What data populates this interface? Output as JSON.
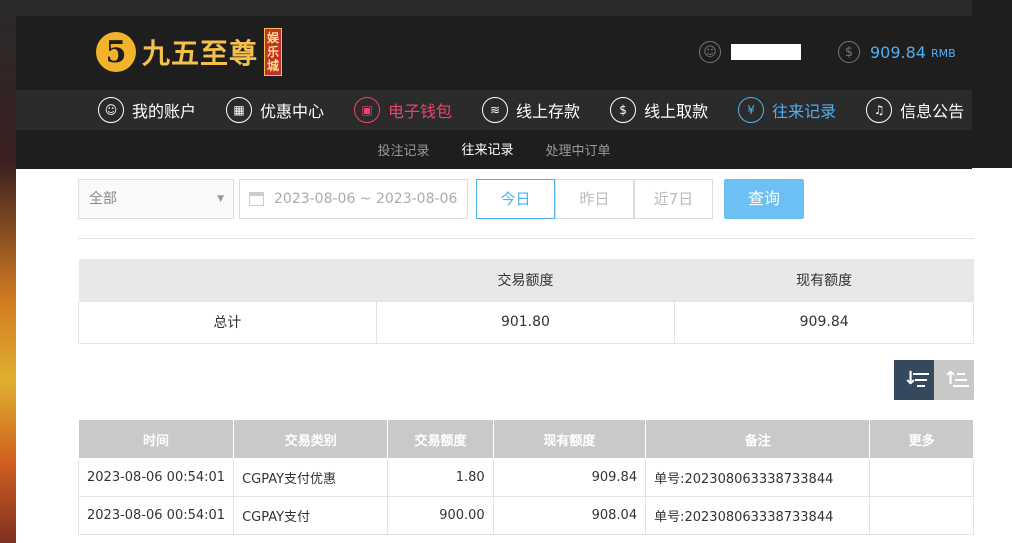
{
  "brand": {
    "name": "九五至尊",
    "badge": "娱乐城",
    "mark": "5"
  },
  "header": {
    "balance": "909.84",
    "currency": "RMB"
  },
  "nav": {
    "items": [
      {
        "label": "我的账户",
        "icon": "user-icon",
        "glyph": "☺"
      },
      {
        "label": "优惠中心",
        "icon": "gift-icon",
        "glyph": "▦"
      },
      {
        "label": "电子钱包",
        "icon": "wallet-icon",
        "glyph": "▣"
      },
      {
        "label": "线上存款",
        "icon": "deposit-icon",
        "glyph": "≋"
      },
      {
        "label": "线上取款",
        "icon": "withdraw-icon",
        "glyph": "$"
      },
      {
        "label": "往来记录",
        "icon": "records-icon",
        "glyph": "¥"
      },
      {
        "label": "信息公告",
        "icon": "bell-icon",
        "glyph": "♫"
      }
    ]
  },
  "subnav": {
    "items": [
      {
        "label": "投注记录"
      },
      {
        "label": "往来记录"
      },
      {
        "label": "处理中订单"
      }
    ]
  },
  "filters": {
    "type_value": "全部",
    "date_range": "2023-08-06 ~ 2023-08-06",
    "quick": [
      "今日",
      "昨日",
      "近7日"
    ],
    "query_label": "查询"
  },
  "summary": {
    "headers": [
      "",
      "交易额度",
      "现有额度"
    ],
    "row": [
      "总计",
      "901.80",
      "909.84"
    ]
  },
  "records": {
    "headers": [
      "时间",
      "交易类别",
      "交易额度",
      "现有额度",
      "备注",
      "更多"
    ],
    "rows": [
      [
        "2023-08-06 00:54:01",
        "CGPAY支付优惠",
        "1.80",
        "909.84",
        "单号:202308063338733844",
        ""
      ],
      [
        "2023-08-06 00:54:01",
        "CGPAY支付",
        "900.00",
        "908.04",
        "单号:202308063338733844",
        ""
      ]
    ]
  },
  "colors": {
    "accent_blue": "#4fb0f0",
    "accent_red": "#e8466c",
    "brand_gold": "#f4c14a",
    "header_dark": "#1e1e1e"
  }
}
